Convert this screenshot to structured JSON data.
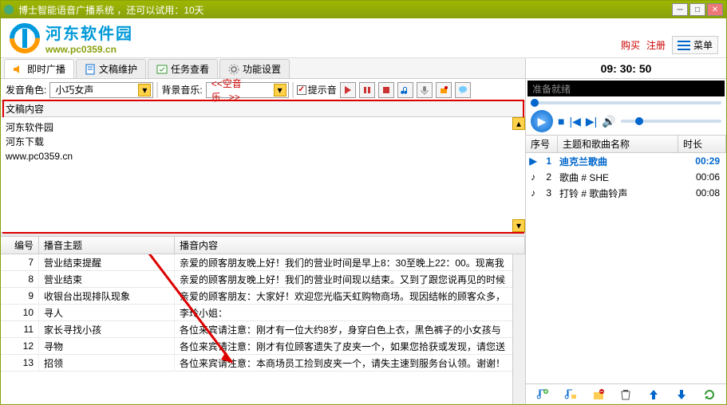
{
  "window": {
    "title": "博士智能语音广播系统 ，还可以试用：10天"
  },
  "logo": {
    "cn": "河东软件园",
    "en": "www.pc0359.cn"
  },
  "header_links": {
    "buy": "购买",
    "register": "注册",
    "menu": "菜单"
  },
  "tabs": [
    {
      "label": "即时广播",
      "icon": "speaker"
    },
    {
      "label": "文稿维护",
      "icon": "doc"
    },
    {
      "label": "任务查看",
      "icon": "task"
    },
    {
      "label": "功能设置",
      "icon": "gear"
    }
  ],
  "toolbar": {
    "voice_label": "发音角色:",
    "voice_value": "小巧女声",
    "bgm_label": "背景音乐:",
    "bgm_value": "<<空音乐...>>",
    "tip_sound": "提示音"
  },
  "content": {
    "header": "文稿内容",
    "lines": [
      "河东软件园",
      "河东下载",
      "www.pc0359.cn"
    ]
  },
  "table": {
    "headers": {
      "num": "编号",
      "topic": "播音主题",
      "content": "播音内容"
    },
    "rows": [
      {
        "num": "7",
        "topic": "营业结束提醒",
        "content": "亲爱的顾客朋友晚上好！我们的营业时间是早上8：30至晚上22：00。现离我"
      },
      {
        "num": "8",
        "topic": "营业结束",
        "content": "亲爱的顾客朋友晚上好！我们的营业时间现以结束。又到了跟您说再见的时候"
      },
      {
        "num": "9",
        "topic": "收银台出现排队现象",
        "content": "亲爱的顾客朋友：大家好！欢迎您光临天虹购物商场。现因结帐的顾客众多，"
      },
      {
        "num": "10",
        "topic": "寻人",
        "content": "李玲小姐："
      },
      {
        "num": "11",
        "topic": "家长寻找小孩",
        "content": "各位来宾请注意：刚才有一位大约8岁，身穿白色上衣，黑色裤子的小女孩与"
      },
      {
        "num": "12",
        "topic": "寻物",
        "content": "各位来宾请注意：刚才有位顾客遗失了皮夹一个，如果您拾获或发现，请您送"
      },
      {
        "num": "13",
        "topic": "招领",
        "content": "各位来宾请注意：本商场员工捡到皮夹一个，请失主速到服务台认领。谢谢！"
      }
    ]
  },
  "clock": "09: 30: 50",
  "player": {
    "status": "准备就绪"
  },
  "playlist": {
    "headers": {
      "seq": "序号",
      "name": "主题和歌曲名称",
      "dur": "时长"
    },
    "rows": [
      {
        "seq": "1",
        "name": "迪克兰歌曲",
        "dur": "00:29",
        "playing": true
      },
      {
        "seq": "2",
        "name": "歌曲 # SHE",
        "dur": "00:06",
        "playing": false
      },
      {
        "seq": "3",
        "name": "打铃 # 歌曲铃声",
        "dur": "00:08",
        "playing": false
      }
    ]
  }
}
